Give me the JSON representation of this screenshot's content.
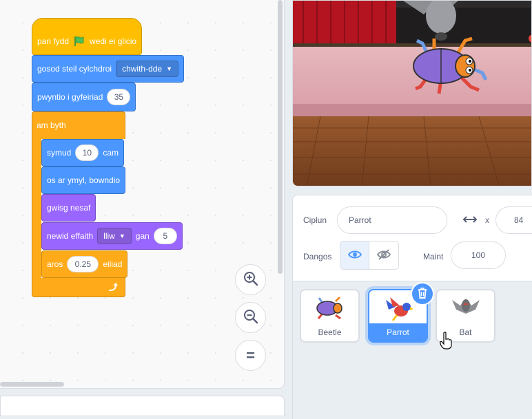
{
  "code": {
    "hat": {
      "before": "pan fydd",
      "after": "wedi ei glicio",
      "flag_icon": "green-flag-icon"
    },
    "rotation": {
      "label": "gosod steil cylchdroi",
      "value": "chwith-dde"
    },
    "point": {
      "label": "pwyntio i gyfeiriad",
      "value": "35"
    },
    "forever": {
      "label": "am byth"
    },
    "move": {
      "label": "symud",
      "value": "10",
      "suffix": "cam"
    },
    "bounce": {
      "label": "os ar ymyl, bowndio"
    },
    "costume": {
      "label": "gwisg nesaf"
    },
    "effect": {
      "label": "newid effaith",
      "value": "lliw",
      "by": "gan",
      "amount": "5"
    },
    "wait": {
      "label": "aros",
      "value": "0.25",
      "suffix": "eiliad"
    },
    "loop_icon": "loop-arrow-icon"
  },
  "zoom": {
    "in_icon": "zoom-in-icon",
    "out_icon": "zoom-out-icon",
    "reset_icon": "zoom-reset-icon",
    "reset_glyph": "="
  },
  "sprite_info": {
    "name_label": "Ciplun",
    "name_value": "Parrot",
    "x_label": "x",
    "x_value": "84",
    "show_label": "Dangos",
    "size_label": "Maint",
    "size_value": "100"
  },
  "sprites": [
    {
      "name": "Beetle",
      "selected": false
    },
    {
      "name": "Parrot",
      "selected": true
    },
    {
      "name": "Bat",
      "selected": false
    }
  ],
  "colors": {
    "motion": "#4c97ff",
    "looks": "#9966ff",
    "events": "#ffbf00",
    "control": "#ffab19",
    "accent": "#4c97ff"
  }
}
